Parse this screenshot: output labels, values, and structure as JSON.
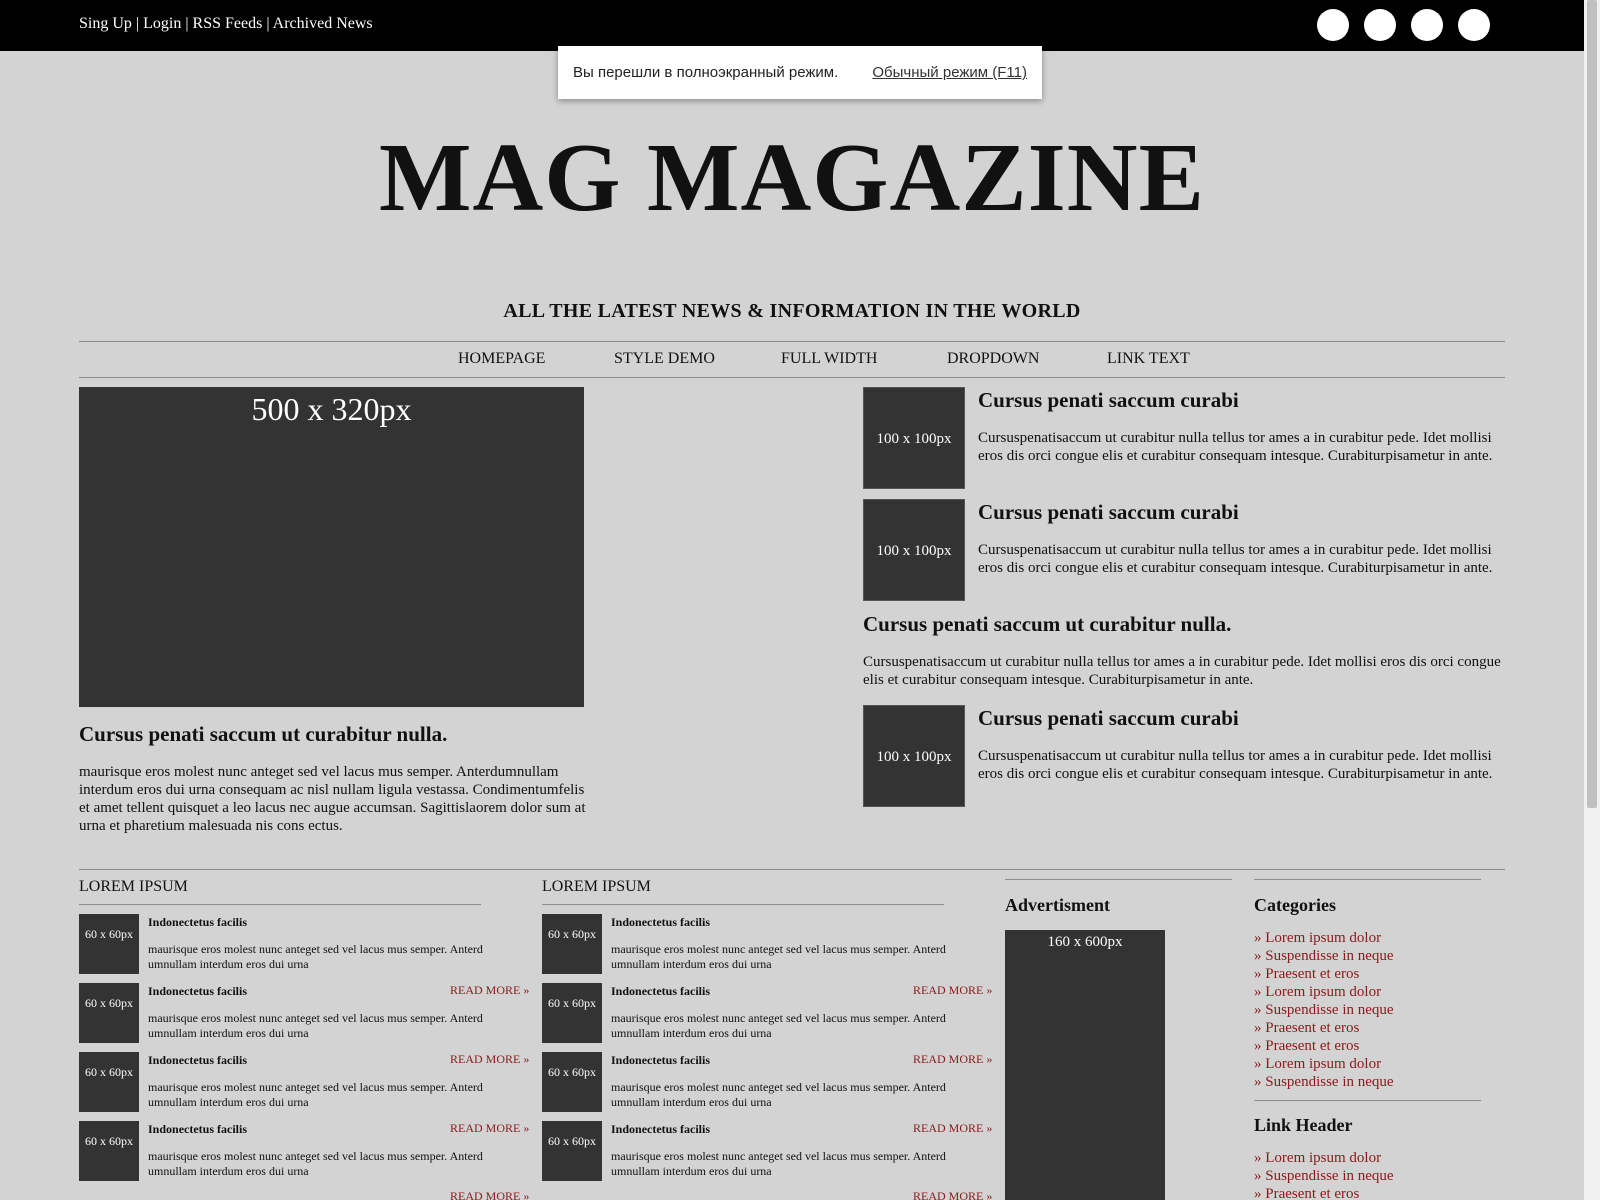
{
  "topbar": {
    "links": [
      "Sing Up",
      "Login",
      "RSS Feeds",
      "Archived News"
    ],
    "separator": "|"
  },
  "fullscreen_notice": {
    "message": "Вы перешли в полноэкранный режим.",
    "exit_label": "Обычный режим (F11)"
  },
  "masthead": {
    "title": "MAG MAGAZINE",
    "tagline": "ALL THE LATEST NEWS & INFORMATION IN THE WORLD"
  },
  "nav": [
    "HOMEPAGE",
    "STYLE DEMO",
    "FULL WIDTH",
    "DROPDOWN",
    "LINK TEXT"
  ],
  "feature": {
    "image_label": "500 x 320px",
    "title": "Cursus penati saccum ut curabitur nulla.",
    "text": "maurisque eros molest nunc anteget sed vel lacus mus semper. Anterdumnullam interdum eros dui urna consequam ac nisl nullam ligula vestassa. Condimentumfelis et amet tellent quisquet a leo lacus nec augue accumsan. Sagittislaorem dolor sum at urna et pharetium malesuada nis cons ectus."
  },
  "articles": [
    {
      "thumb": "100 x 100px",
      "title": "Cursus penati saccum curabi",
      "text": "Cursuspenatisaccum ut curabitur nulla tellus tor ames a in curabitur pede. Idet mollisi eros dis orci congue elis et curabitur consequam intesque. Curabiturpisametur in ante."
    },
    {
      "thumb": "100 x 100px",
      "title": "Cursus penati saccum curabi",
      "text": "Cursuspenatisaccum ut curabitur nulla tellus tor ames a in curabitur pede. Idet mollisi eros dis orci congue elis et curabitur consequam intesque. Curabiturpisametur in ante."
    },
    {
      "thumb": "",
      "title": "Cursus penati saccum ut curabitur nulla.",
      "text": "Cursuspenatisaccum ut curabitur nulla tellus tor ames a in curabitur pede. Idet mollisi eros dis orci congue elis et curabitur consequam intesque. Curabiturpisametur in ante."
    },
    {
      "thumb": "100 x 100px",
      "title": "Cursus penati saccum curabi",
      "text": "Cursuspenatisaccum ut curabitur nulla tellus tor ames a in curabitur pede. Idet mollisi eros dis orci congue elis et curabitur consequam intesque. Curabiturpisametur in ante."
    }
  ],
  "lorem_columns": [
    {
      "heading": "LOREM IPSUM",
      "items": [
        {
          "thumb": "60 x 60px",
          "title": "Indonectetus facilis",
          "text": "maurisque eros molest nunc anteget sed vel lacus mus semper. Anterd umnullam interdum eros dui urna"
        },
        {
          "thumb": "60 x 60px",
          "title": "Indonectetus facilis",
          "text": "maurisque eros molest nunc anteget sed vel lacus mus semper. Anterd umnullam interdum eros dui urna"
        },
        {
          "thumb": "60 x 60px",
          "title": "Indonectetus facilis",
          "text": "maurisque eros molest nunc anteget sed vel lacus mus semper. Anterd umnullam interdum eros dui urna"
        },
        {
          "thumb": "60 x 60px",
          "title": "Indonectetus facilis",
          "text": "maurisque eros molest nunc anteget sed vel lacus mus semper. Anterd umnullam interdum eros dui urna"
        }
      ],
      "read_more": "READ MORE »"
    },
    {
      "heading": "LOREM IPSUM",
      "items": [
        {
          "thumb": "60 x 60px",
          "title": "Indonectetus facilis",
          "text": "maurisque eros molest nunc anteget sed vel lacus mus semper. Anterd umnullam interdum eros dui urna"
        },
        {
          "thumb": "60 x 60px",
          "title": "Indonectetus facilis",
          "text": "maurisque eros molest nunc anteget sed vel lacus mus semper. Anterd umnullam interdum eros dui urna"
        },
        {
          "thumb": "60 x 60px",
          "title": "Indonectetus facilis",
          "text": "maurisque eros molest nunc anteget sed vel lacus mus semper. Anterd umnullam interdum eros dui urna"
        },
        {
          "thumb": "60 x 60px",
          "title": "Indonectetus facilis",
          "text": "maurisque eros molest nunc anteget sed vel lacus mus semper. Anterd umnullam interdum eros dui urna"
        }
      ],
      "read_more": "READ MORE »"
    }
  ],
  "advertisment": {
    "heading": "Advertisment",
    "box_label": "160 x 600px"
  },
  "categories": {
    "heading": "Categories",
    "links": [
      "» Lorem ipsum dolor",
      "» Suspendisse in neque",
      "» Praesent et eros",
      "» Lorem ipsum dolor",
      "» Suspendisse in neque",
      "» Praesent et eros",
      "» Praesent et eros",
      "» Lorem ipsum dolor",
      "» Suspendisse in neque"
    ]
  },
  "link_header": {
    "heading": "Link Header",
    "links": [
      "» Lorem ipsum dolor",
      "» Suspendisse in neque",
      "» Praesent et eros"
    ]
  },
  "colors": {
    "page_bg": "#d3d3d3",
    "topbar_bg": "#000000",
    "placeholder_bg": "#333333",
    "link_red": "#8b1a1a"
  }
}
